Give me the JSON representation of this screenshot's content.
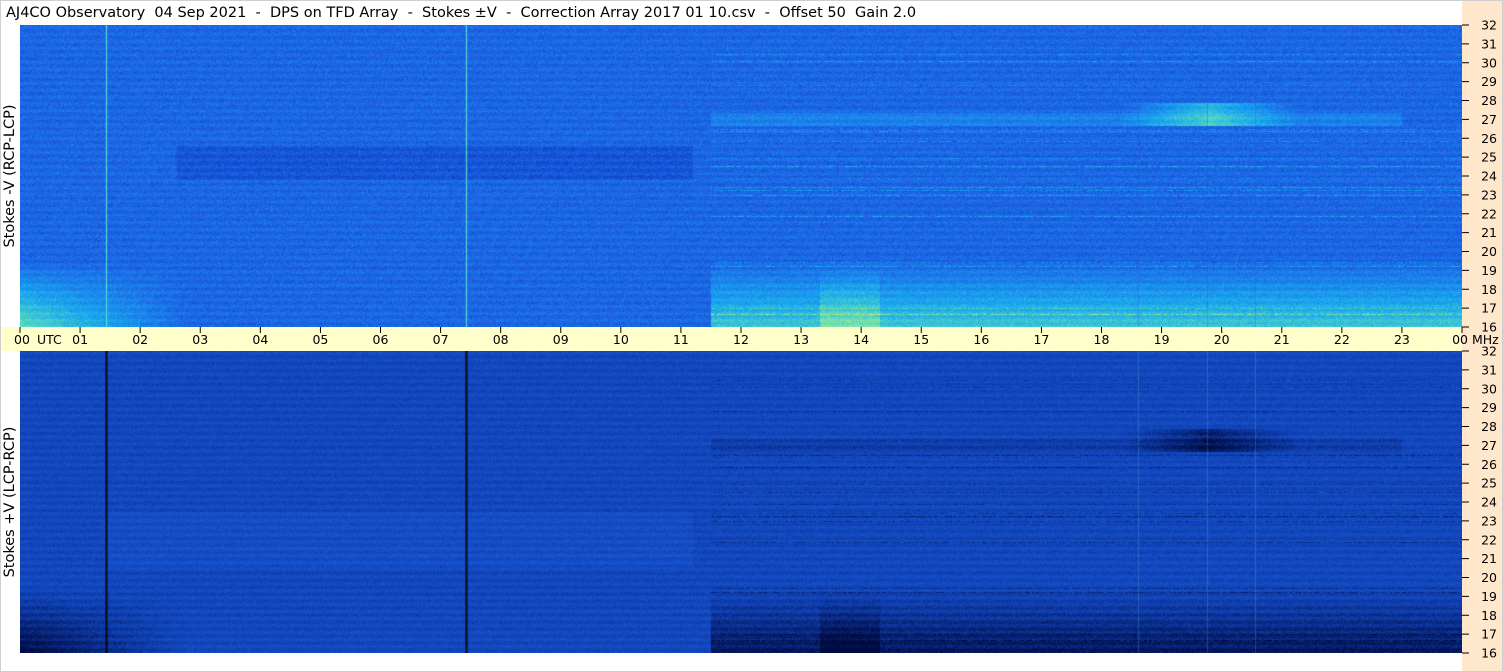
{
  "header": {
    "title": "AJ4CO Observatory  04 Sep 2021  -  DPS on TFD Array  -  Stokes ±V  -  Correction Array 2017 01 10.csv  -  Offset 50  Gain 2.0"
  },
  "chart_data": {
    "type": "heatmap",
    "title": "AJ4CO Observatory  04 Sep 2021  -  DPS on TFD Array  -  Stokes ±V  -  Correction Array 2017 01 10.csv  -  Offset 50  Gain 2.0",
    "x_axis": {
      "unit_label": "UTC",
      "tick_labels": [
        "00",
        "01",
        "02",
        "03",
        "04",
        "05",
        "06",
        "07",
        "08",
        "09",
        "10",
        "11",
        "12",
        "13",
        "14",
        "15",
        "16",
        "17",
        "18",
        "19",
        "20",
        "21",
        "22",
        "23",
        "00"
      ],
      "range_hours": [
        0,
        24
      ]
    },
    "y_axis": {
      "unit_label": "MHz",
      "tick_labels": [
        "32",
        "31",
        "30",
        "29",
        "28",
        "27",
        "26",
        "25",
        "24",
        "23",
        "22",
        "21",
        "20",
        "19",
        "18",
        "17",
        "16"
      ],
      "range_mhz": [
        16,
        32
      ]
    },
    "panels": [
      {
        "name": "top",
        "ylabel": "Stokes -V (RCP-LCP)",
        "colormap": [
          "#0030b0",
          "#1e62e6",
          "#18a8f0",
          "#60e0b8",
          "#f0f060",
          "#f07040"
        ]
      },
      {
        "name": "bottom",
        "ylabel": "Stokes +V (LCP-RCP)",
        "colormap": [
          "#000a40",
          "#0f3fb0",
          "#1e62e6",
          "#18a8f0",
          "#60e0b8"
        ]
      }
    ],
    "vertical_markers_utc_hours": [
      1.5,
      7.5
    ],
    "grid": false
  }
}
